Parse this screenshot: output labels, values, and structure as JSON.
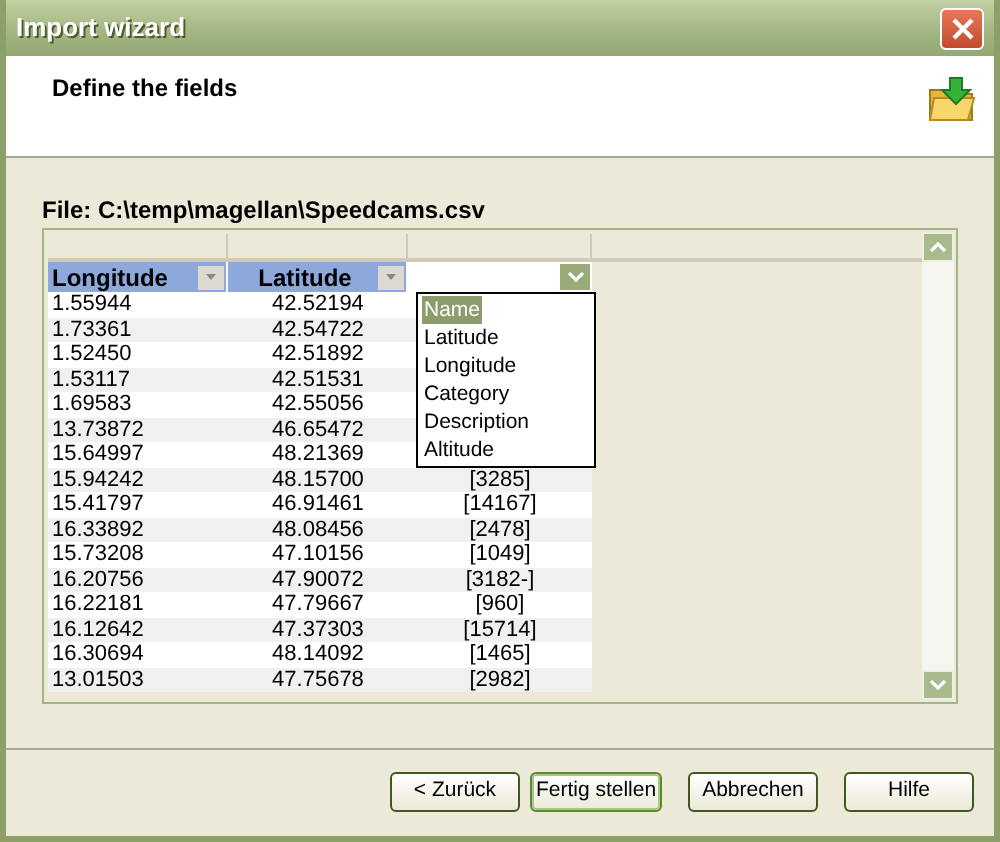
{
  "window": {
    "title": "Import wizard"
  },
  "header": {
    "title": "Define the fields"
  },
  "file_label": "File: C:\\temp\\magellan\\Speedcams.csv",
  "field_dropdown": {
    "expanded": true,
    "options": [
      {
        "label": "Name",
        "selected": true
      },
      {
        "label": "Latitude",
        "selected": false
      },
      {
        "label": "Longitude",
        "selected": false
      },
      {
        "label": "Category",
        "selected": false
      },
      {
        "label": "Description",
        "selected": false
      },
      {
        "label": "Altitude",
        "selected": false
      }
    ]
  },
  "table": {
    "columns": [
      {
        "label": "Longitude",
        "kind": "sorted"
      },
      {
        "label": "Latitude",
        "kind": "sorted"
      }
    ],
    "rows": [
      {
        "cells": [
          "1.55944",
          "42.52194"
        ]
      },
      {
        "cells": [
          "1.73361",
          "42.54722"
        ]
      },
      {
        "cells": [
          "1.52450",
          "42.51892"
        ]
      },
      {
        "cells": [
          "1.53117",
          "42.51531"
        ]
      },
      {
        "cells": [
          "1.69583",
          "42.55056"
        ]
      },
      {
        "cells": [
          "13.73872",
          "46.65472"
        ]
      },
      {
        "cells": [
          "15.64997",
          "48.21369"
        ]
      },
      {
        "cells": [
          "15.94242",
          "48.15700",
          "[3285]"
        ]
      },
      {
        "cells": [
          "15.41797",
          "46.91461",
          "[14167]"
        ]
      },
      {
        "cells": [
          "16.33892",
          "48.08456",
          "[2478]"
        ]
      },
      {
        "cells": [
          "15.73208",
          "47.10156",
          "[1049]"
        ]
      },
      {
        "cells": [
          "16.20756",
          "47.90072",
          "[3182-]"
        ]
      },
      {
        "cells": [
          "16.22181",
          "47.79667",
          "[960]"
        ]
      },
      {
        "cells": [
          "16.12642",
          "47.37303",
          "[15714]"
        ]
      },
      {
        "cells": [
          "16.30694",
          "48.14092",
          "[1465]"
        ]
      },
      {
        "cells": [
          "13.01503",
          "47.75678",
          "[2982]"
        ]
      }
    ]
  },
  "buttons": [
    {
      "label": "< Zurück",
      "focused": false
    },
    {
      "label": "Fertig stellen",
      "focused": true
    },
    {
      "label": "Abbrechen",
      "focused": false
    },
    {
      "label": "Hilfe",
      "focused": false
    }
  ]
}
